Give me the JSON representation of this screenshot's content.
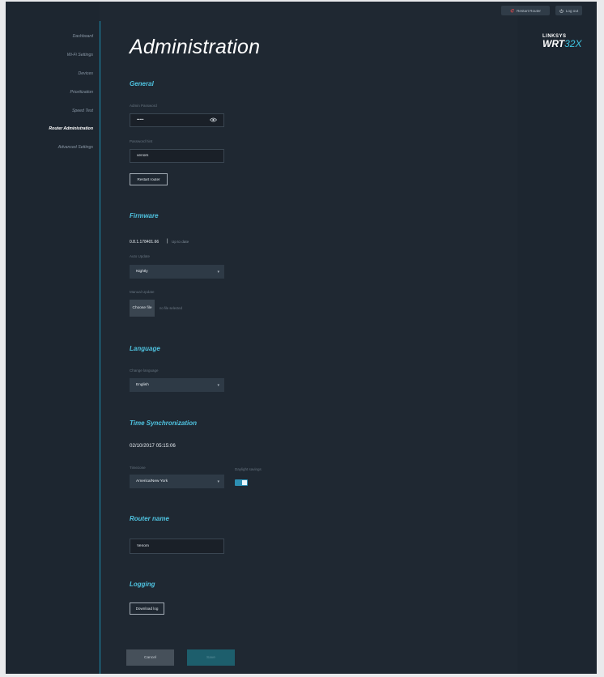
{
  "header": {
    "restart_label": "Restart Router",
    "logout_label": "Log out"
  },
  "logo": {
    "brand": "LINKSYS",
    "model_main": "WRT",
    "model_accent": "32X"
  },
  "sidebar": {
    "items": [
      {
        "label": "Dashboard"
      },
      {
        "label": "Wi-Fi Settings"
      },
      {
        "label": "Devices"
      },
      {
        "label": "Prioritization"
      },
      {
        "label": "Speed Test"
      },
      {
        "label": "Router Administration"
      },
      {
        "label": "Advanced Settings"
      }
    ]
  },
  "page_title": "Administration",
  "general": {
    "title": "General",
    "admin_password_label": "Admin Password",
    "admin_password_value": "•••••",
    "password_hint_label": "Password hint",
    "password_hint_value": "venom",
    "restart_button": "Restart router"
  },
  "firmware": {
    "title": "Firmware",
    "version": "0.8.1.178401.66",
    "status": "Up to date",
    "auto_update_label": "Auto Update",
    "auto_update_value": "Nightly",
    "manual_update_label": "Manual Update",
    "choose_file_label": "Choose file",
    "no_file_text": "no file selected"
  },
  "language": {
    "title": "Language",
    "change_label": "Change language",
    "value": "English"
  },
  "time_sync": {
    "title": "Time Synchronization",
    "datetime": "02/10/2017 05:15:06",
    "timezone_label": "Timezone",
    "timezone_value": "America/New York",
    "daylight_label": "Daylight savings",
    "daylight_on": true
  },
  "router_name": {
    "title": "Router name",
    "value": "Venom"
  },
  "logging": {
    "title": "Logging",
    "download_label": "Download log"
  },
  "footer": {
    "cancel_label": "Cancel",
    "save_label": "Save"
  },
  "colors": {
    "accent": "#4fc3e0",
    "background": "#1f2832",
    "toggle_on": "#2d8fb3"
  }
}
